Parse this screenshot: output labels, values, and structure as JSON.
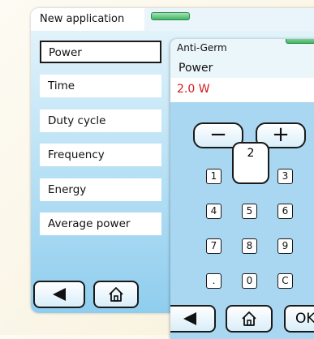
{
  "left_panel": {
    "title": "New application",
    "menu": [
      {
        "label": "Power",
        "selected": true
      },
      {
        "label": "Time",
        "selected": false
      },
      {
        "label": "Duty cycle",
        "selected": false
      },
      {
        "label": "Frequency",
        "selected": false
      },
      {
        "label": "Energy",
        "selected": false
      },
      {
        "label": "Average power",
        "selected": false
      }
    ],
    "back_icon": "left-triangle-icon",
    "home_icon": "home-icon"
  },
  "right_panel": {
    "program": "Anti-Germ",
    "parameter": "Power",
    "value": "2.0 W",
    "minus": "−",
    "plus": "+",
    "pressed_key": "2",
    "keys": [
      "1",
      "3",
      "4",
      "5",
      "6",
      "7",
      "8",
      "9",
      ".",
      "0",
      "C"
    ],
    "ok_label": "OK",
    "back_icon": "left-triangle-icon",
    "home_icon": "home-icon"
  },
  "colors": {
    "value_red": "#d7191f",
    "panel_blue": "#a9d7f1",
    "tab_green": "#41b465"
  }
}
